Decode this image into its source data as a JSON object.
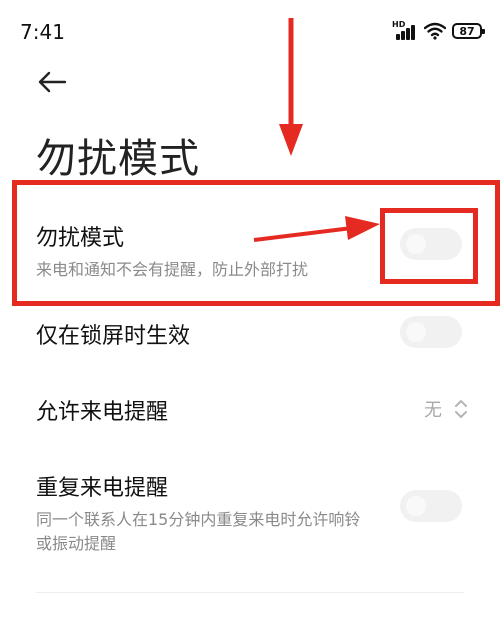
{
  "status_bar": {
    "time": "7:41",
    "network_label": "HD",
    "battery": "87"
  },
  "header": {
    "back_icon": "arrow-left-icon",
    "title": "勿扰模式"
  },
  "settings": {
    "dnd": {
      "title": "勿扰模式",
      "subtitle": "来电和通知不会有提醒，防止外部打扰",
      "enabled": false
    },
    "lock_screen_only": {
      "title": "仅在锁屏时生效",
      "enabled": false
    },
    "allow_calls": {
      "title": "允许来电提醒",
      "value": "无",
      "icon": "chevron-updown-icon"
    },
    "repeat_calls": {
      "title": "重复来电提醒",
      "subtitle_line1": "同一个联系人在15分钟内重复来电时允许响铃",
      "subtitle_line2": "或振动提醒",
      "enabled": false
    }
  },
  "annotation": {
    "color": "#e52a22"
  },
  "colors": {
    "background": "#ffffff",
    "secondary_text": "#8a8a8a",
    "toggle_off": "#f1f1f1"
  }
}
